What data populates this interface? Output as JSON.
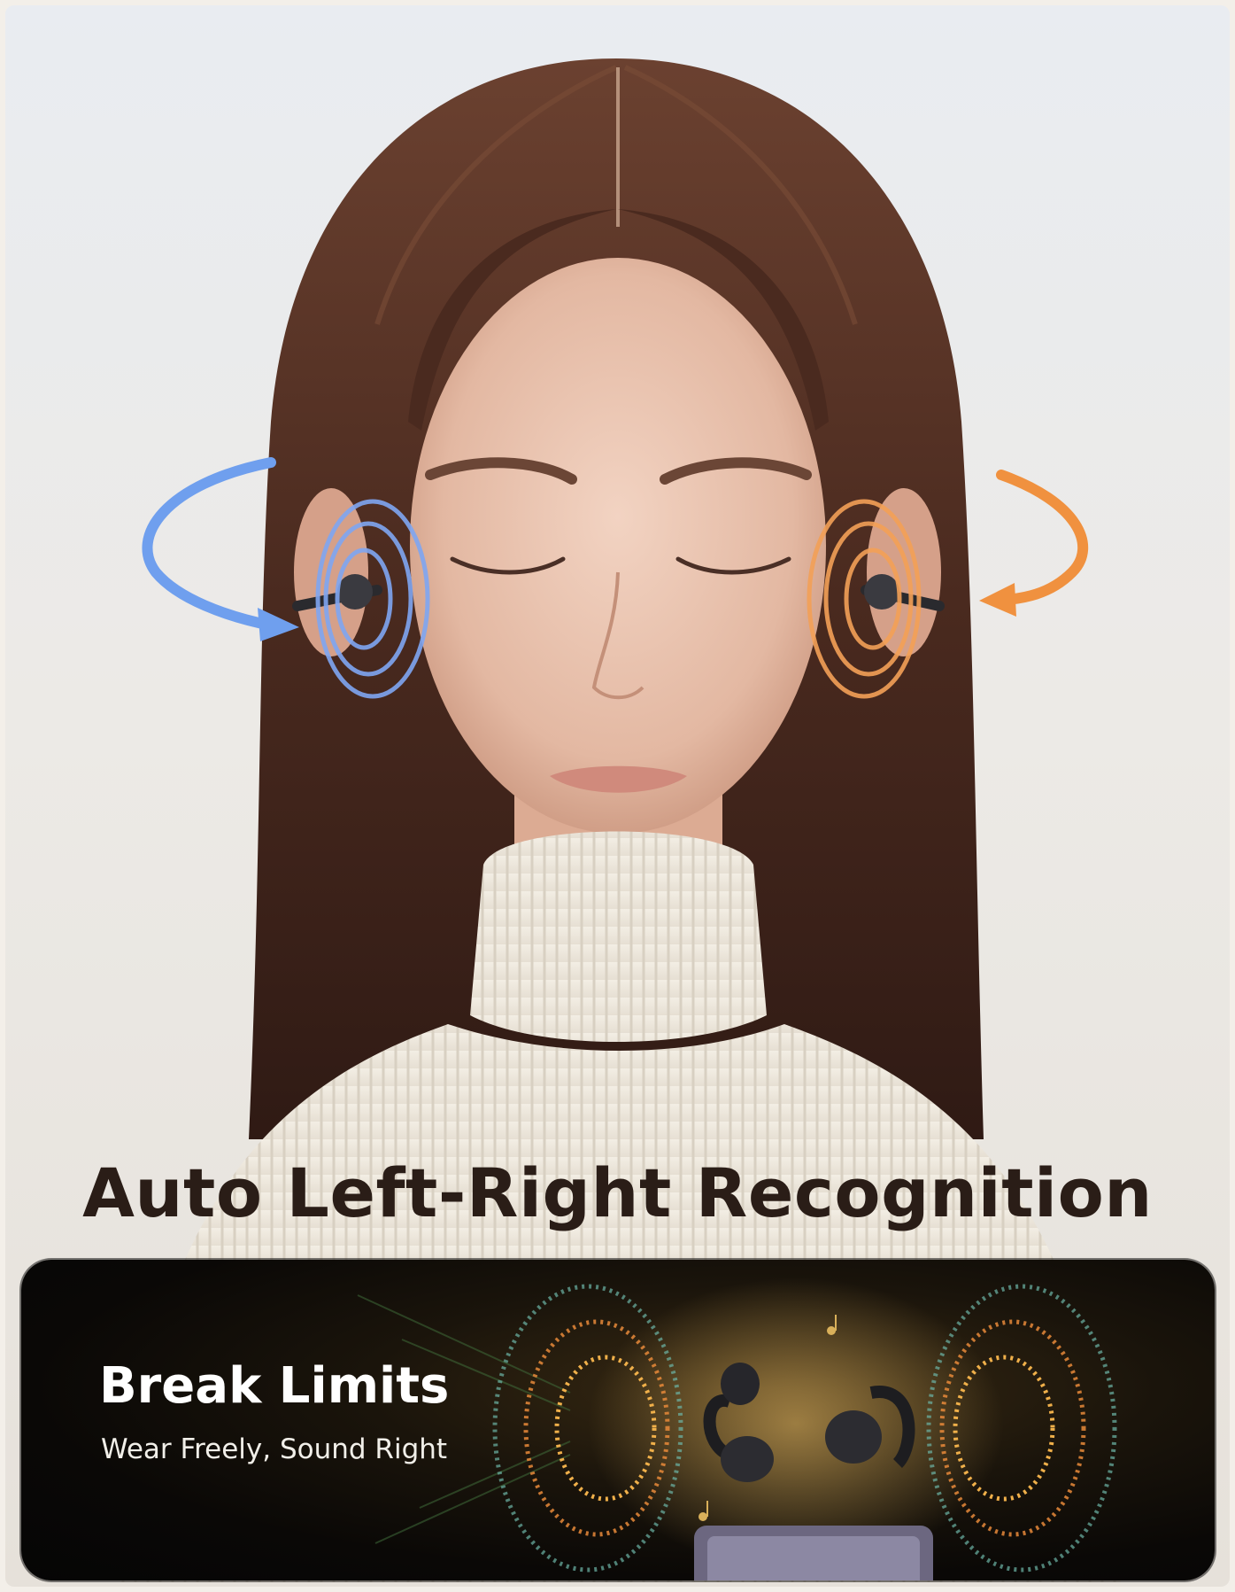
{
  "headline": "Auto Left-Right Recognition",
  "banner": {
    "title": "Break Limits",
    "subtitle": "Wear Freely, Sound Right"
  },
  "colors": {
    "left_channel": "#6f9fee",
    "right_channel": "#f0913f",
    "headline_text": "#2a1d17",
    "banner_bg": "#0a0806"
  },
  "icons": [
    "rotation-arrow-left-icon",
    "rotation-arrow-right-icon",
    "sound-wave-icon",
    "music-note-icon"
  ]
}
